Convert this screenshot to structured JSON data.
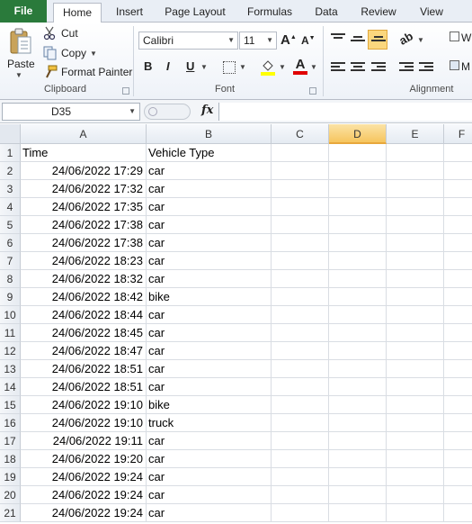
{
  "tabs": [
    "File",
    "Home",
    "Insert",
    "Page Layout",
    "Formulas",
    "Data",
    "Review",
    "View"
  ],
  "clipboard": {
    "paste": "Paste",
    "cut": "Cut",
    "copy": "Copy",
    "format_painter": "Format Painter",
    "group_label": "Clipboard"
  },
  "font": {
    "name": "Calibri",
    "size": "11",
    "group_label": "Font",
    "bold": "B",
    "italic": "I",
    "underline": "U",
    "grow": "A",
    "shrink": "A",
    "color": "A"
  },
  "alignment": {
    "group_label": "Alignment",
    "wrap_partial": "W",
    "merge_partial": "M"
  },
  "formula_bar": {
    "name_box": "D35",
    "fx": "fx",
    "value": ""
  },
  "sheet": {
    "columns": [
      "A",
      "B",
      "C",
      "D",
      "E",
      "F"
    ],
    "selected_column": "D",
    "rows": [
      {
        "n": "1",
        "a": "Time",
        "b": "Vehicle Type"
      },
      {
        "n": "2",
        "a": "24/06/2022 17:29",
        "b": "car"
      },
      {
        "n": "3",
        "a": "24/06/2022 17:32",
        "b": "car"
      },
      {
        "n": "4",
        "a": "24/06/2022 17:35",
        "b": "car"
      },
      {
        "n": "5",
        "a": "24/06/2022 17:38",
        "b": "car"
      },
      {
        "n": "6",
        "a": "24/06/2022 17:38",
        "b": "car"
      },
      {
        "n": "7",
        "a": "24/06/2022 18:23",
        "b": "car"
      },
      {
        "n": "8",
        "a": "24/06/2022 18:32",
        "b": "car"
      },
      {
        "n": "9",
        "a": "24/06/2022 18:42",
        "b": "bike"
      },
      {
        "n": "10",
        "a": "24/06/2022 18:44",
        "b": "car"
      },
      {
        "n": "11",
        "a": "24/06/2022 18:45",
        "b": "car"
      },
      {
        "n": "12",
        "a": "24/06/2022 18:47",
        "b": "car"
      },
      {
        "n": "13",
        "a": "24/06/2022 18:51",
        "b": "car"
      },
      {
        "n": "14",
        "a": "24/06/2022 18:51",
        "b": "car"
      },
      {
        "n": "15",
        "a": "24/06/2022 19:10",
        "b": "bike"
      },
      {
        "n": "16",
        "a": "24/06/2022 19:10",
        "b": "truck"
      },
      {
        "n": "17",
        "a": "24/06/2022 19:11",
        "b": "car"
      },
      {
        "n": "18",
        "a": "24/06/2022 19:20",
        "b": "car"
      },
      {
        "n": "19",
        "a": "24/06/2022 19:24",
        "b": "car"
      },
      {
        "n": "20",
        "a": "24/06/2022 19:24",
        "b": "car"
      },
      {
        "n": "21",
        "a": "24/06/2022 19:24",
        "b": "car"
      }
    ]
  },
  "colors": {
    "file_tab": "#2a7a3b",
    "selected_header": "#f6c55e",
    "grid_line": "#d9dde3"
  }
}
